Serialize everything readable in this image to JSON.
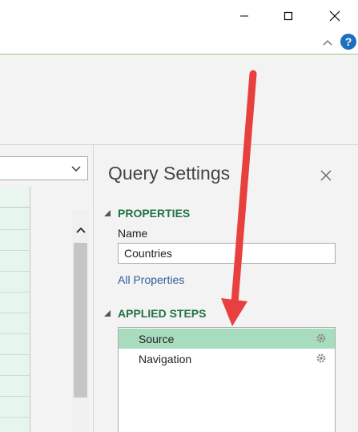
{
  "window": {
    "minimize_icon": "minimize-icon",
    "maximize_icon": "maximize-icon",
    "close_icon": "close-icon"
  },
  "ribbon": {
    "collapse_icon": "chevron-up-icon",
    "help_label": "?"
  },
  "query_settings": {
    "title": "Query Settings",
    "properties": {
      "heading": "PROPERTIES",
      "name_label": "Name",
      "name_value": "Countries",
      "all_properties_link": "All Properties"
    },
    "applied_steps": {
      "heading": "APPLIED STEPS",
      "steps": [
        {
          "label": "Source",
          "selected": true
        },
        {
          "label": "Navigation",
          "selected": false
        }
      ]
    }
  },
  "colors": {
    "accent_green": "#217346",
    "selected_step": "#a7dcbf",
    "link_blue": "#2e5f9e",
    "annotation_arrow": "#e8403f"
  }
}
